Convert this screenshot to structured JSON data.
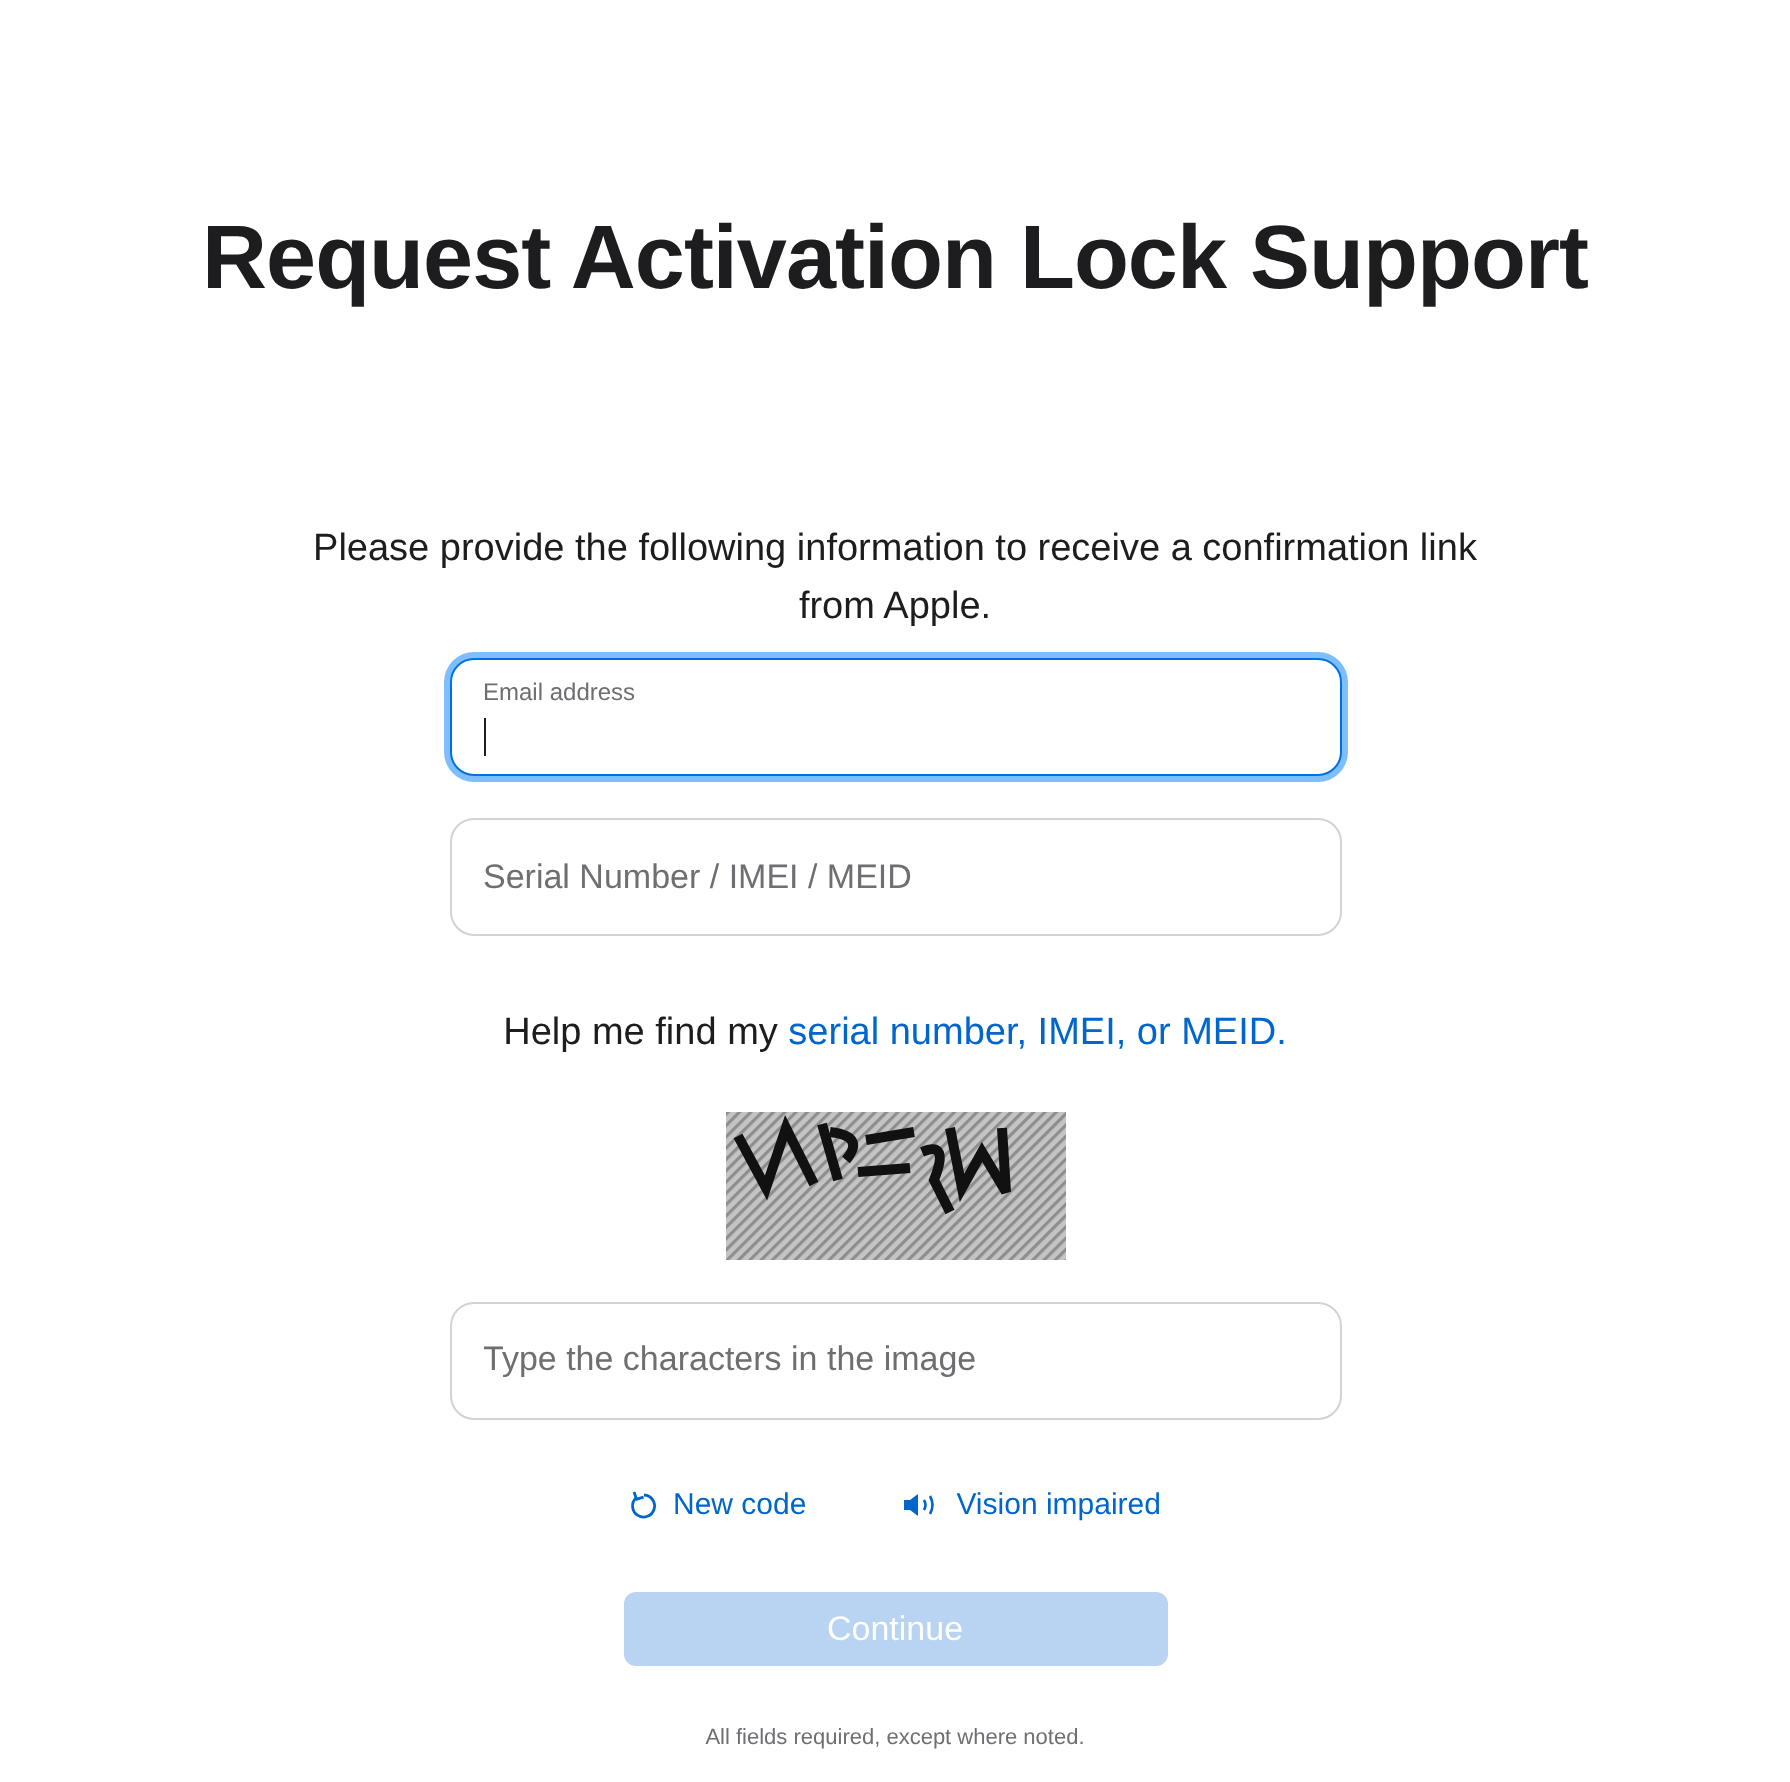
{
  "title": "Request Activation Lock Support",
  "intro": "Please provide the following information to receive a confirmation link from Apple.",
  "fields": [
    {
      "label": "Email address",
      "focused": true
    },
    {
      "placeholder": "Serial Number / IMEI / MEID",
      "focused": false
    }
  ],
  "help": {
    "text": "Help me find my",
    "link": "serial number, IMEI, or MEID."
  },
  "captcha_field": {
    "placeholder": "Type the characters in the image",
    "focused": false
  },
  "captcha_links": [
    {
      "kind": "refresh",
      "label": "New code"
    },
    {
      "kind": "audio",
      "label": "Vision impaired"
    }
  ],
  "continue_button": {
    "label": "Continue",
    "disabled": true
  },
  "footnote": "All fields required, except where noted."
}
